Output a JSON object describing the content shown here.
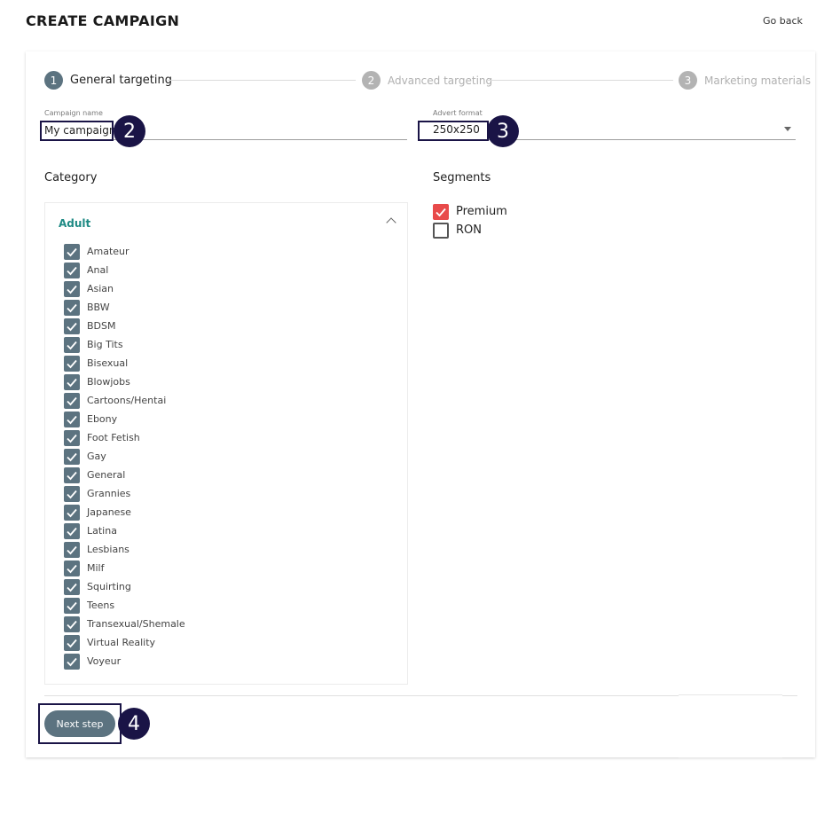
{
  "header": {
    "title": "CREATE CAMPAIGN",
    "go_back": "Go back"
  },
  "stepper": [
    {
      "num": "1",
      "label": "General targeting",
      "state": "active"
    },
    {
      "num": "2",
      "label": "Advanced targeting",
      "state": "inactive"
    },
    {
      "num": "3",
      "label": "Marketing materials",
      "state": "inactive"
    }
  ],
  "campaign_name": {
    "label": "Campaign name",
    "value": "My campaign"
  },
  "advert_format": {
    "label": "Advert format",
    "value": "250x250"
  },
  "category": {
    "title": "Category",
    "group": "Adult",
    "items": [
      "Amateur",
      "Anal",
      "Asian",
      "BBW",
      "BDSM",
      "Big Tits",
      "Bisexual",
      "Blowjobs",
      "Cartoons/Hentai",
      "Ebony",
      "Foot Fetish",
      "Gay",
      "General",
      "Grannies",
      "Japanese",
      "Latina",
      "Lesbians",
      "Milf",
      "Squirting",
      "Teens",
      "Transexual/Shemale",
      "Virtual Reality",
      "Voyeur"
    ]
  },
  "segments": {
    "title": "Segments",
    "items": [
      {
        "label": "Premium",
        "checked": true
      },
      {
        "label": "RON",
        "checked": false
      }
    ]
  },
  "next_button": "Next step",
  "annotations": [
    "2",
    "3",
    "4"
  ],
  "colors": {
    "accent": "#5c7380",
    "group_title": "#1e8a84",
    "premium_check": "#e84a4a",
    "annotation": "#1a1446"
  }
}
